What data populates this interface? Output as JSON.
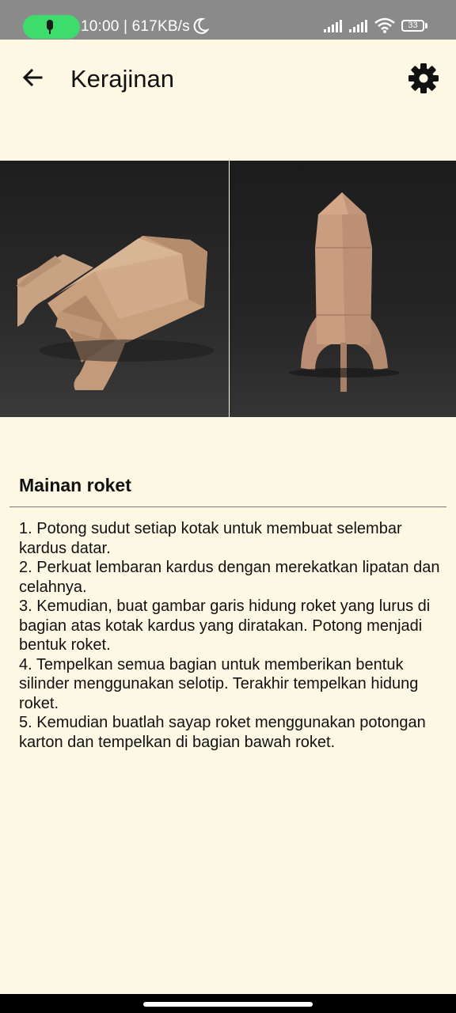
{
  "status_bar": {
    "text": "10:00 | 617KB/s",
    "battery_level": "33"
  },
  "app_bar": {
    "title": "Kerajinan"
  },
  "content": {
    "section_title": "Mainan roket",
    "steps_text": "1. Potong sudut setiap kotak untuk membuat selembar kardus datar.\n2. Perkuat lembaran kardus dengan merekatkan lipatan dan celahnya.\n3. Kemudian, buat gambar garis hidung roket yang lurus di bagian atas kotak kardus yang diratakan. Potong menjadi bentuk roket.\n4. Tempelkan semua bagian untuk memberikan bentuk silinder menggunakan selotip. Terakhir tempelkan hidung roket.\n5. Kemudian buatlah sayap roket menggunakan potongan karton dan tempelkan di bagian bawah roket."
  },
  "colors": {
    "background": "#fdf8e3",
    "status_bar": "#8a8a8a",
    "mic_pill": "#3ddc6c",
    "cardboard": "#c9a07e"
  },
  "icons": {
    "back": "arrow-left-icon",
    "settings": "gear-icon"
  }
}
